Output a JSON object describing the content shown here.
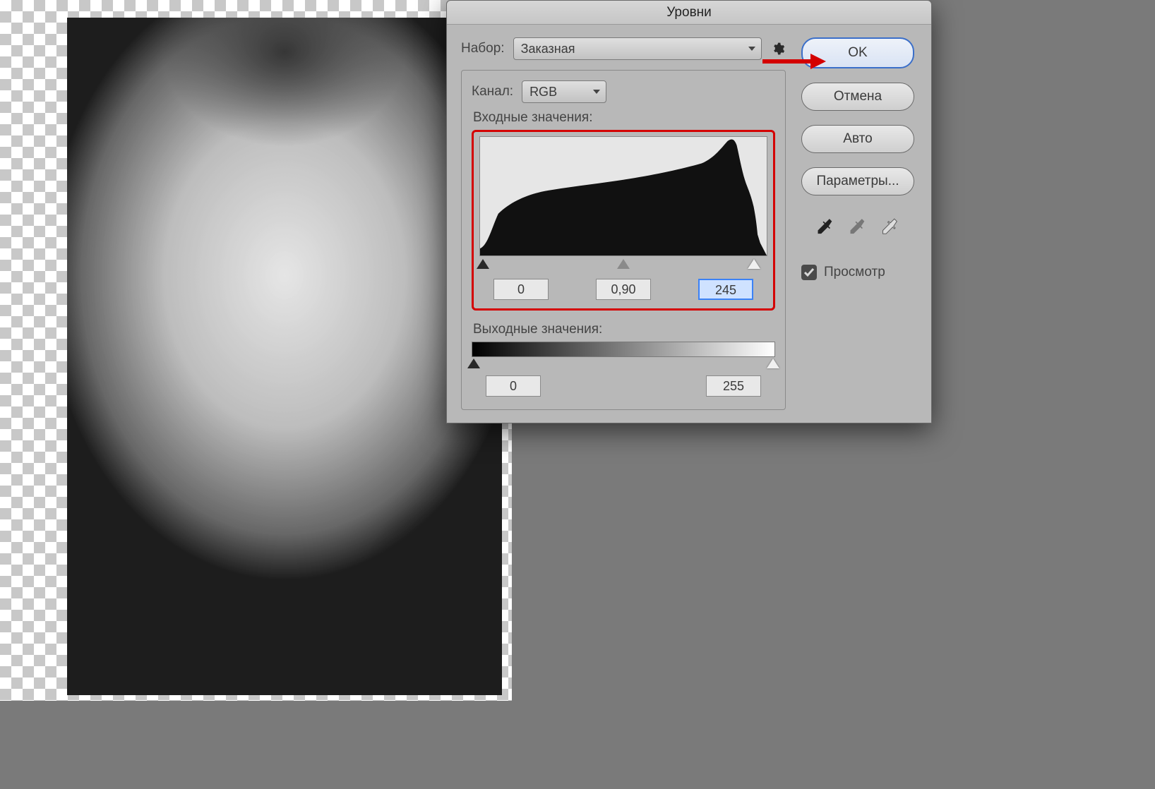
{
  "dialog": {
    "title": "Уровни",
    "preset_label": "Набор:",
    "preset_value": "Заказная",
    "channel_label": "Канал:",
    "channel_value": "RGB",
    "input_label": "Входные значения:",
    "output_label": "Выходные значения:",
    "input_black": "0",
    "input_gamma": "0,90",
    "input_white": "245",
    "output_black": "0",
    "output_white": "255"
  },
  "buttons": {
    "ok": "OK",
    "cancel": "Отмена",
    "auto": "Авто",
    "options": "Параметры..."
  },
  "preview": {
    "label": "Просмотр",
    "checked": true
  }
}
